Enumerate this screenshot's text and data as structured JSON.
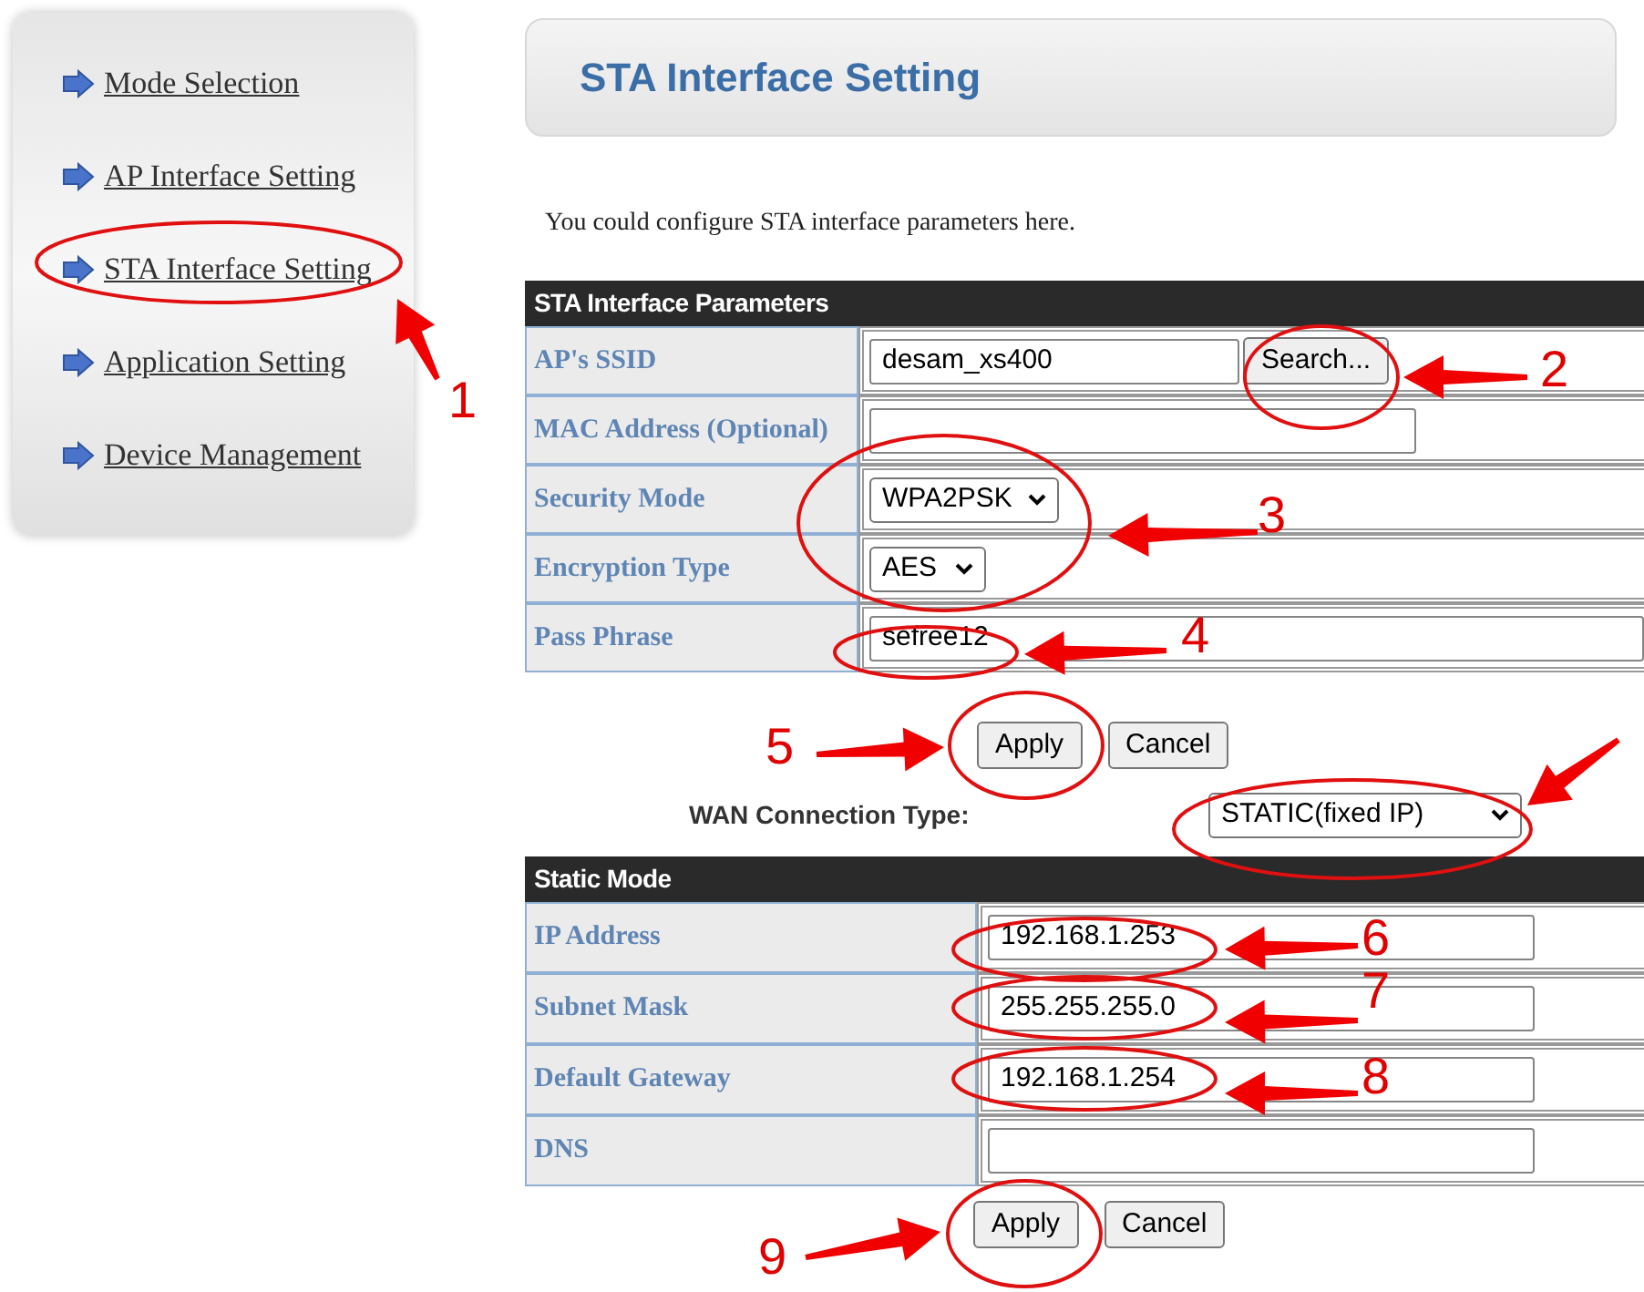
{
  "sidebar": {
    "items": [
      {
        "label": "Mode Selection"
      },
      {
        "label": "AP Interface Setting"
      },
      {
        "label": "STA Interface Setting"
      },
      {
        "label": "Application Setting"
      },
      {
        "label": "Device Management"
      }
    ]
  },
  "header": {
    "title": "STA Interface Setting"
  },
  "description": "You could configure STA interface parameters here.",
  "sta_table": {
    "title": "STA Interface Parameters",
    "rows": [
      {
        "kind": "input_button",
        "label": "AP's SSID",
        "value": "desam_xs400",
        "button": "Search..."
      },
      {
        "kind": "input",
        "label": "MAC Address (Optional)"
      },
      {
        "kind": "select",
        "label": "Security Mode",
        "value": "WPA2PSK"
      },
      {
        "kind": "select",
        "label": "Encryption Type",
        "value": "AES"
      },
      {
        "kind": "input_wide",
        "label": "Pass Phrase",
        "value": "sefree12"
      }
    ]
  },
  "sta_buttons": [
    "Apply",
    "Cancel"
  ],
  "wan": {
    "label": "WAN Connection Type:",
    "value": "STATIC(fixed IP)"
  },
  "static_table": {
    "title": "Static Mode",
    "rows": [
      {
        "label": "IP Address",
        "value": "192.168.1.253"
      },
      {
        "label": "Subnet Mask",
        "value": "255.255.255.0"
      },
      {
        "label": "Default Gateway",
        "value": "192.168.1.254"
      },
      {
        "label": "DNS"
      }
    ]
  },
  "static_buttons": [
    "Apply",
    "Cancel"
  ],
  "annotations": [
    "1",
    "2",
    "3",
    "4",
    "5",
    "6",
    "7",
    "8",
    "9"
  ]
}
